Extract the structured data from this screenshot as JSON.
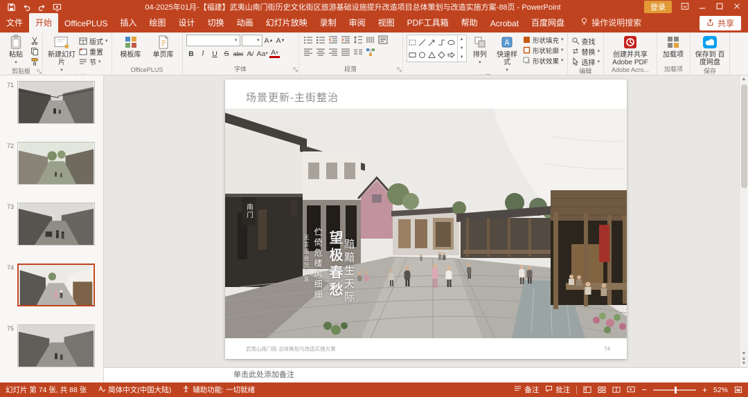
{
  "title_bar": {
    "title": "04-2025年01月-【福建】武夷山南门街历史文化街区旅游基础设施提升改造项目总体策划与改造实施方案-88页 - PowerPoint",
    "sign_in": "登录"
  },
  "icons": {
    "quick_access": [
      "save",
      "undo",
      "redo",
      "start-slideshow"
    ],
    "window": [
      "ribbon-display-options",
      "minimize",
      "maximize",
      "close"
    ],
    "status_views": [
      "normal-view",
      "slide-sorter",
      "reading-view",
      "slideshow"
    ]
  },
  "tabs": [
    {
      "label": "文件"
    },
    {
      "label": "开始",
      "active": true
    },
    {
      "label": "OfficePLUS"
    },
    {
      "label": "插入"
    },
    {
      "label": "绘图"
    },
    {
      "label": "设计"
    },
    {
      "label": "切换"
    },
    {
      "label": "动画"
    },
    {
      "label": "幻灯片放映"
    },
    {
      "label": "录制"
    },
    {
      "label": "审阅"
    },
    {
      "label": "视图"
    },
    {
      "label": "PDF工具箱"
    },
    {
      "label": "帮助"
    },
    {
      "label": "Acrobat"
    },
    {
      "label": "百度网盘"
    }
  ],
  "search_label": "操作说明搜索",
  "share_label": "共享",
  "ribbon": {
    "clipboard": {
      "paste": "粘贴",
      "label": "剪贴板"
    },
    "slides": {
      "new_slide": "新建幻灯片",
      "layout": "版式",
      "reset": "重置",
      "section": "节",
      "label": "幻灯片"
    },
    "officeplus": {
      "templates": "模板库",
      "pages": "单页库",
      "label": "OfficePLUS"
    },
    "font": {
      "bold": "B",
      "italic": "I",
      "underline": "U",
      "shadow": "S",
      "strike": "abc",
      "spacing": "AV",
      "case": "Aa",
      "color": "A",
      "grow": "A",
      "shrink": "A",
      "label": "字体"
    },
    "paragraph": {
      "label": "段落"
    },
    "drawing": {
      "arrange": "排列",
      "quick_styles": "快速样式",
      "shape_fill": "形状填充",
      "shape_outline": "形状轮廓",
      "shape_effects": "形状效果",
      "label": "绘图"
    },
    "editing": {
      "find": "查找",
      "replace": "替换",
      "select": "选择",
      "label": "编辑"
    },
    "adobe": {
      "button": "创建并共享 Adobe PDF",
      "label": "Adobe Acro..."
    },
    "addins": {
      "button": "加载项",
      "label": "加载项"
    },
    "baidu": {
      "button": "保存到 百度网盘",
      "label": "保存"
    }
  },
  "thumbnails": [
    {
      "number": "71"
    },
    {
      "number": "72"
    },
    {
      "number": "73"
    },
    {
      "number": "74",
      "selected": true
    },
    {
      "number": "75"
    }
  ],
  "slide": {
    "title": "场景更新-主街整治",
    "overlay": {
      "sign_nanmen": "南门",
      "poem_small": "无言谁会凭阑意",
      "poem_med": "伫倚危楼风细细",
      "poem_big1": "望极春愁",
      "poem_big2": "黯黯生天际"
    },
    "footer": "武夷山南门街 总体策划与改造实施方案",
    "page_number": "74"
  },
  "notes": {
    "placeholder": "单击此处添加备注"
  },
  "status_bar": {
    "slide_info": "幻灯片 第 74 张, 共 88 张",
    "language": "简体中文(中国大陆)",
    "accessibility": "辅助功能: 一切就绪",
    "notes_label": "备注",
    "comments_label": "批注",
    "zoom": "52%"
  },
  "colors": {
    "accent": "#C0431F",
    "ribbon_bg": "#f6f4f2",
    "canvas_bg": "#e9e7e4"
  }
}
